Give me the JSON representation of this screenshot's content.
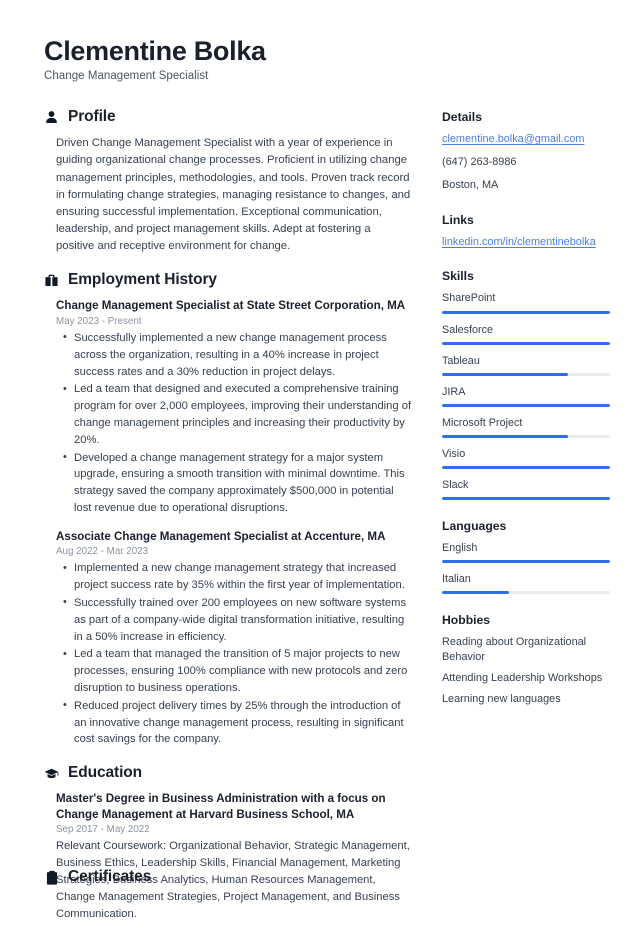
{
  "header": {
    "name": "Clementine Bolka",
    "title": "Change Management Specialist"
  },
  "colors": {
    "accent": "#2f6fed",
    "link": "#4a7fe0",
    "heading": "#1a202c",
    "body_text": "#374151",
    "muted_date": "#8b93a1",
    "bar_track": "#e9eaec",
    "background": "#ffffff"
  },
  "sections": {
    "profile": {
      "icon": "user-icon",
      "title": "Profile",
      "text": "Driven Change Management Specialist with a year of experience in guiding organizational change processes. Proficient in utilizing change management principles, methodologies, and tools. Proven track record in formulating change strategies, managing resistance to changes, and ensuring successful implementation. Exceptional communication, leadership, and project management skills. Adept at fostering a positive and receptive environment for change."
    },
    "employment": {
      "icon": "briefcase-icon",
      "title": "Employment History",
      "entries": [
        {
          "title": "Change Management Specialist at State Street Corporation, MA",
          "date": "May 2023 - Present",
          "bullets": [
            "Successfully implemented a new change management process across the organization, resulting in a 40% increase in project success rates and a 30% reduction in project delays.",
            "Led a team that designed and executed a comprehensive training program for over 2,000 employees, improving their understanding of change management principles and increasing their productivity by 20%.",
            "Developed a change management strategy for a major system upgrade, ensuring a smooth transition with minimal downtime. This strategy saved the company approximately $500,000 in potential lost revenue due to operational disruptions."
          ]
        },
        {
          "title": "Associate Change Management Specialist at Accenture, MA",
          "date": "Aug 2022 - Mar 2023",
          "bullets": [
            "Implemented a new change management strategy that increased project success rate by 35% within the first year of implementation.",
            "Successfully trained over 200 employees on new software systems as part of a company-wide digital transformation initiative, resulting in a 50% increase in efficiency.",
            "Led a team that managed the transition of 5 major projects to new processes, ensuring 100% compliance with new protocols and zero disruption to business operations.",
            "Reduced project delivery times by 25% through the introduction of an innovative change management process, resulting in significant cost savings for the company."
          ]
        }
      ]
    },
    "education": {
      "icon": "graduation-cap-icon",
      "title": "Education",
      "entries": [
        {
          "title": "Master's Degree in Business Administration with a focus on Change Management at Harvard Business School, MA",
          "date": "Sep 2017 - May 2022",
          "description": "Relevant Coursework: Organizational Behavior, Strategic Management, Business Ethics, Leadership Skills, Financial Management, Marketing Strategies, Business Analytics, Human Resources Management, Change Management Strategies, Project Management, and Business Communication."
        }
      ]
    },
    "certificates": {
      "icon": "certificate-icon",
      "title": "Certificates"
    }
  },
  "sidebar": {
    "details": {
      "title": "Details",
      "email": "clementine.bolka@gmail.com",
      "phone": "(647) 263-8986",
      "location": "Boston, MA"
    },
    "links": {
      "title": "Links",
      "items": [
        {
          "label": "linkedin.com/in/clementinebolka"
        }
      ]
    },
    "skills": {
      "title": "Skills",
      "items": [
        {
          "label": "SharePoint",
          "level": 100
        },
        {
          "label": "Salesforce",
          "level": 100
        },
        {
          "label": "Tableau",
          "level": 75
        },
        {
          "label": "JIRA",
          "level": 100
        },
        {
          "label": "Microsoft Project",
          "level": 75
        },
        {
          "label": "Visio",
          "level": 100
        },
        {
          "label": "Slack",
          "level": 100
        }
      ]
    },
    "languages": {
      "title": "Languages",
      "items": [
        {
          "label": "English",
          "level": 100
        },
        {
          "label": "Italian",
          "level": 40
        }
      ]
    },
    "hobbies": {
      "title": "Hobbies",
      "items": [
        {
          "label": "Reading about Organizational Behavior"
        },
        {
          "label": "Attending Leadership Workshops"
        },
        {
          "label": "Learning new languages"
        }
      ]
    }
  }
}
